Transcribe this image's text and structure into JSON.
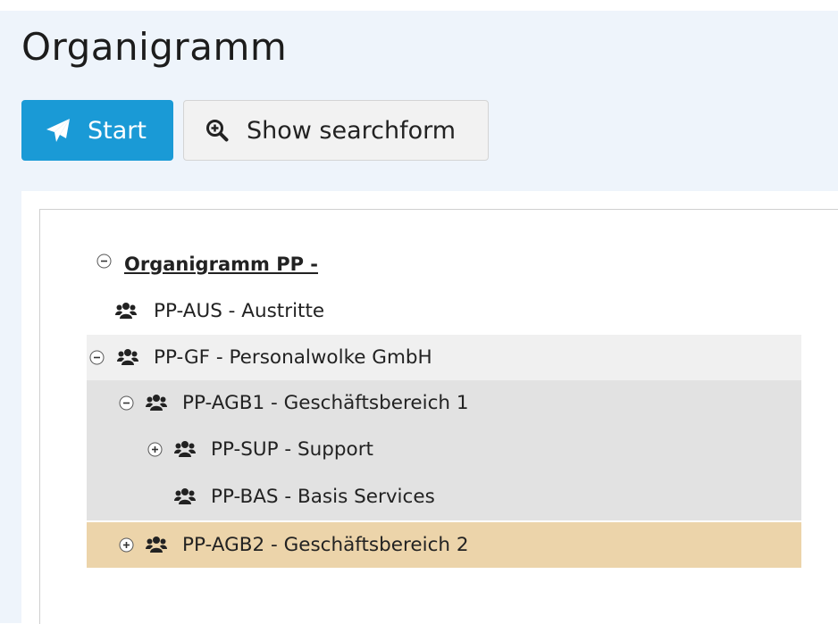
{
  "page": {
    "title": "Organigramm"
  },
  "toolbar": {
    "start_label": "Start",
    "search_label": "Show searchform"
  },
  "tree": {
    "root": {
      "label": "Organigramm PP -",
      "expanded": true
    },
    "nodes": [
      {
        "label": "PP-AUS - Austritte",
        "icon": "users-icon",
        "toggle": "none"
      },
      {
        "label": "PP-GF - Personalwolke GmbH",
        "icon": "users-icon",
        "toggle": "collapse"
      },
      {
        "label": "PP-AGB1 - Geschäftsbereich 1",
        "icon": "users-icon",
        "toggle": "collapse"
      },
      {
        "label": "PP-SUP - Support",
        "icon": "users-icon",
        "toggle": "expand"
      },
      {
        "label": "PP-BAS - Basis Services",
        "icon": "users-icon",
        "toggle": "none"
      },
      {
        "label": "PP-AGB2 - Geschäftsbereich 2",
        "icon": "users-icon",
        "toggle": "expand",
        "selected": true
      }
    ]
  },
  "colors": {
    "primary": "#1a9ad6",
    "page_background": "#eef4fb",
    "row_highlight_light": "#f0f0f0",
    "row_highlight_dark": "#e2e2e2",
    "row_selected": "#ecd4aa"
  }
}
